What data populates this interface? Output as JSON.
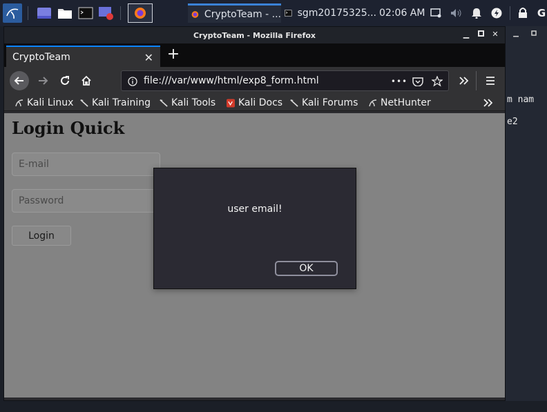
{
  "taskbar": {
    "firefox_task_title": "CryptoTeam - ...",
    "terminal_task_title": "sgm20175325...",
    "clock": "02:06 AM",
    "edge_letter": "G"
  },
  "window": {
    "title": "CryptoTeam - Mozilla Firefox"
  },
  "tab": {
    "title": "CryptoTeam"
  },
  "urlbar": {
    "url": "file:///var/www/html/exp8_form.html",
    "more": "•••"
  },
  "bookmarks": [
    {
      "label": "Kali Linux",
      "icon": "kali-dragon-icon"
    },
    {
      "label": "Kali Training",
      "icon": "kali-dragon-icon"
    },
    {
      "label": "Kali Tools",
      "icon": "kali-dragon-icon"
    },
    {
      "label": "Kali Docs",
      "icon": "kali-docs-icon"
    },
    {
      "label": "Kali Forums",
      "icon": "kali-dragon-icon"
    },
    {
      "label": "NetHunter",
      "icon": "kali-dragon-icon"
    }
  ],
  "page": {
    "heading": "Login Quick",
    "email_placeholder": "E-mail",
    "password_placeholder": "Password",
    "login_label": "Login"
  },
  "dialog": {
    "message": "user email!",
    "ok_label": "OK"
  },
  "terminal": {
    "line1": "m nam",
    "line2": "e2"
  },
  "colors": {
    "panel_bg": "#1d2230",
    "tab_accent": "#0a84ff",
    "page_bg": "#838383",
    "dialog_bg": "#2b2a33"
  }
}
